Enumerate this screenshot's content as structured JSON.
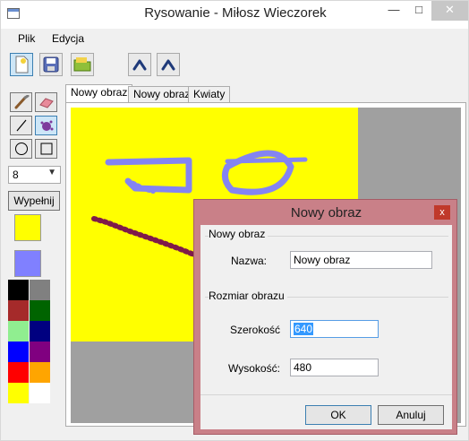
{
  "window": {
    "title": "Rysowanie - Miłosz Wieczorek",
    "minimize_glyph": "—",
    "maximize_glyph": "□",
    "close_glyph": "✕"
  },
  "menu": {
    "items": [
      {
        "label": "Plik"
      },
      {
        "label": "Edycja"
      }
    ]
  },
  "toolbar": {
    "icons": [
      "new-file-icon",
      "save-icon",
      "open-folder-icon",
      "undo-icon",
      "redo-icon"
    ]
  },
  "tools": {
    "icons": [
      "brush-icon",
      "eraser-icon",
      "line-icon",
      "spray-icon",
      "circle-icon",
      "rectangle-icon"
    ],
    "size_value": "8",
    "fill_label": "Wypełnij"
  },
  "colors": {
    "primary": "#ffff00",
    "secondary": "#8080ff",
    "palette": [
      "#000000",
      "#808080",
      "#a52a2a",
      "#006400",
      "#90ee90",
      "#000080",
      "#0000ff",
      "#800080",
      "#ff0000",
      "#ffa500",
      "#ffff00",
      "#ffffff"
    ]
  },
  "tabs": [
    {
      "label": "Nowy obraz",
      "active": true
    },
    {
      "label": "Nowy obraz",
      "active": false
    },
    {
      "label": "Kwiaty",
      "active": false
    }
  ],
  "dialog": {
    "title": "Nowy obraz",
    "close_glyph": "x",
    "group1_label": "Nowy obraz",
    "name_label": "Nazwa:",
    "name_value": "Nowy obraz",
    "group2_label": "Rozmiar obrazu",
    "width_label": "Szerokość",
    "width_value": "640",
    "height_label": "Wysokość:",
    "height_value": "480",
    "ok_label": "OK",
    "cancel_label": "Anuluj"
  }
}
